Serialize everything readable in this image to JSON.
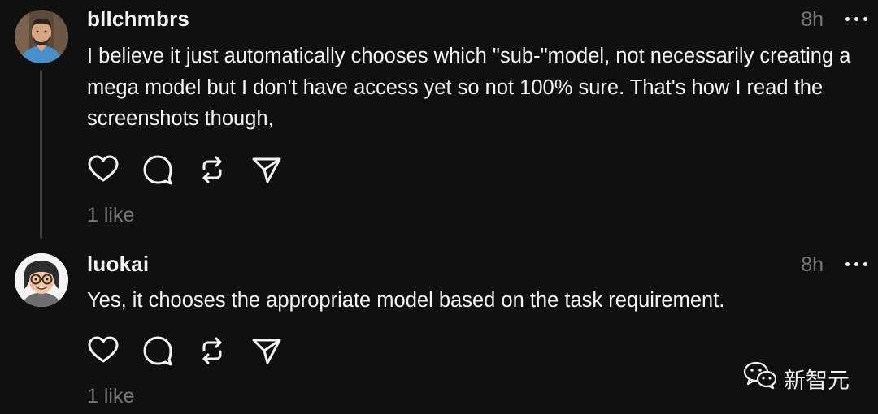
{
  "posts": [
    {
      "username": "bllchmbrs",
      "time": "8h",
      "text": "I believe it just automatically chooses which \"sub-\"model, not necessarily creating a mega model but I don't have access yet so not 100% sure. That's how I read the screenshots though,",
      "likes": "1 like",
      "avatar_icon": "avatar-photo-man-beard"
    },
    {
      "username": "luokai",
      "time": "8h",
      "text": "Yes, it chooses the appropriate model based on the task requirement.",
      "likes": "1 like",
      "avatar_icon": "avatar-cartoon-glasses"
    }
  ],
  "action_icons": [
    "heart-icon",
    "comment-icon",
    "repost-icon",
    "share-icon"
  ],
  "watermark": {
    "icon": "wechat-icon",
    "text": "新智元"
  },
  "colors": {
    "background": "#101010",
    "primary_text": "#f3f5f7",
    "secondary_text": "#777777",
    "thread_line": "#3a3a3a"
  }
}
